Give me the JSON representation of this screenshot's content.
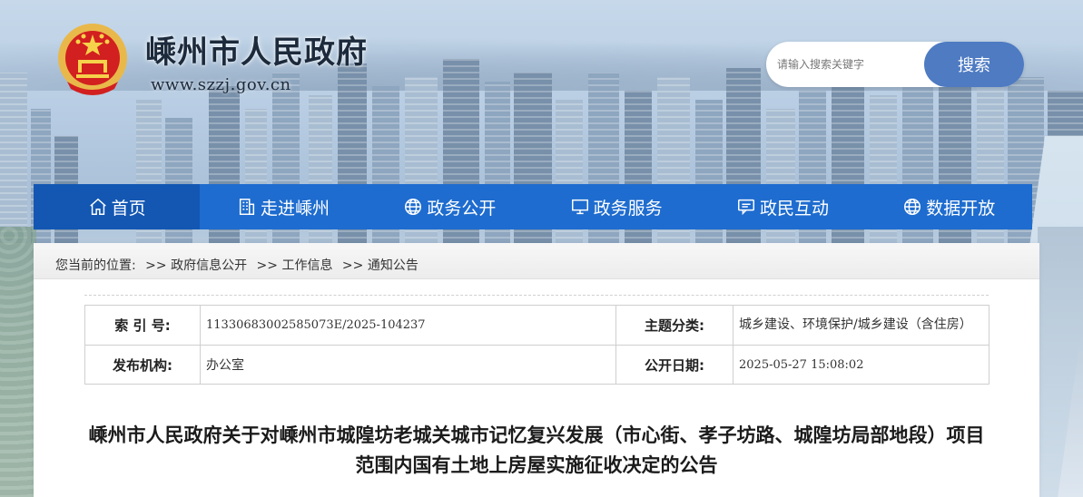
{
  "header": {
    "site_title": "嵊州市人民政府",
    "site_url": "www.szzj.gov.cn",
    "search": {
      "placeholder": "请输入搜索关键字",
      "button_label": "搜索"
    }
  },
  "nav": {
    "items": [
      {
        "label": "首页",
        "icon": "home-icon",
        "active": true
      },
      {
        "label": "走进嵊州",
        "icon": "building-icon"
      },
      {
        "label": "政务公开",
        "icon": "globe-icon"
      },
      {
        "label": "政务服务",
        "icon": "monitor-icon"
      },
      {
        "label": "政民互动",
        "icon": "chat-icon"
      },
      {
        "label": "数据开放",
        "icon": "globe-icon"
      }
    ]
  },
  "breadcrumb": {
    "prefix": "您当前的位置:",
    "items": [
      ">> 政府信息公开",
      ">> 工作信息",
      ">> 通知公告"
    ]
  },
  "meta": {
    "index_label": "索 引 号:",
    "index_value": "11330683002585073E/2025-104237",
    "topic_label": "主题分类:",
    "topic_value": "城乡建设、环境保护/城乡建设（含住房）",
    "org_label": "发布机构:",
    "org_value": "办公室",
    "date_label": "公开日期:",
    "date_value": "2025-05-27 15:08:02"
  },
  "article": {
    "title": "嵊州市人民政府关于对嵊州市城隍坊老城关城市记忆复兴发展（市心街、孝子坊路、城隍坊局部地段）项目范围内国有土地上房屋实施征收决定的公告"
  },
  "colors": {
    "nav_bg": "#1e6ccf",
    "nav_active": "#1357b3",
    "search_btn": "#4e7bc2"
  }
}
